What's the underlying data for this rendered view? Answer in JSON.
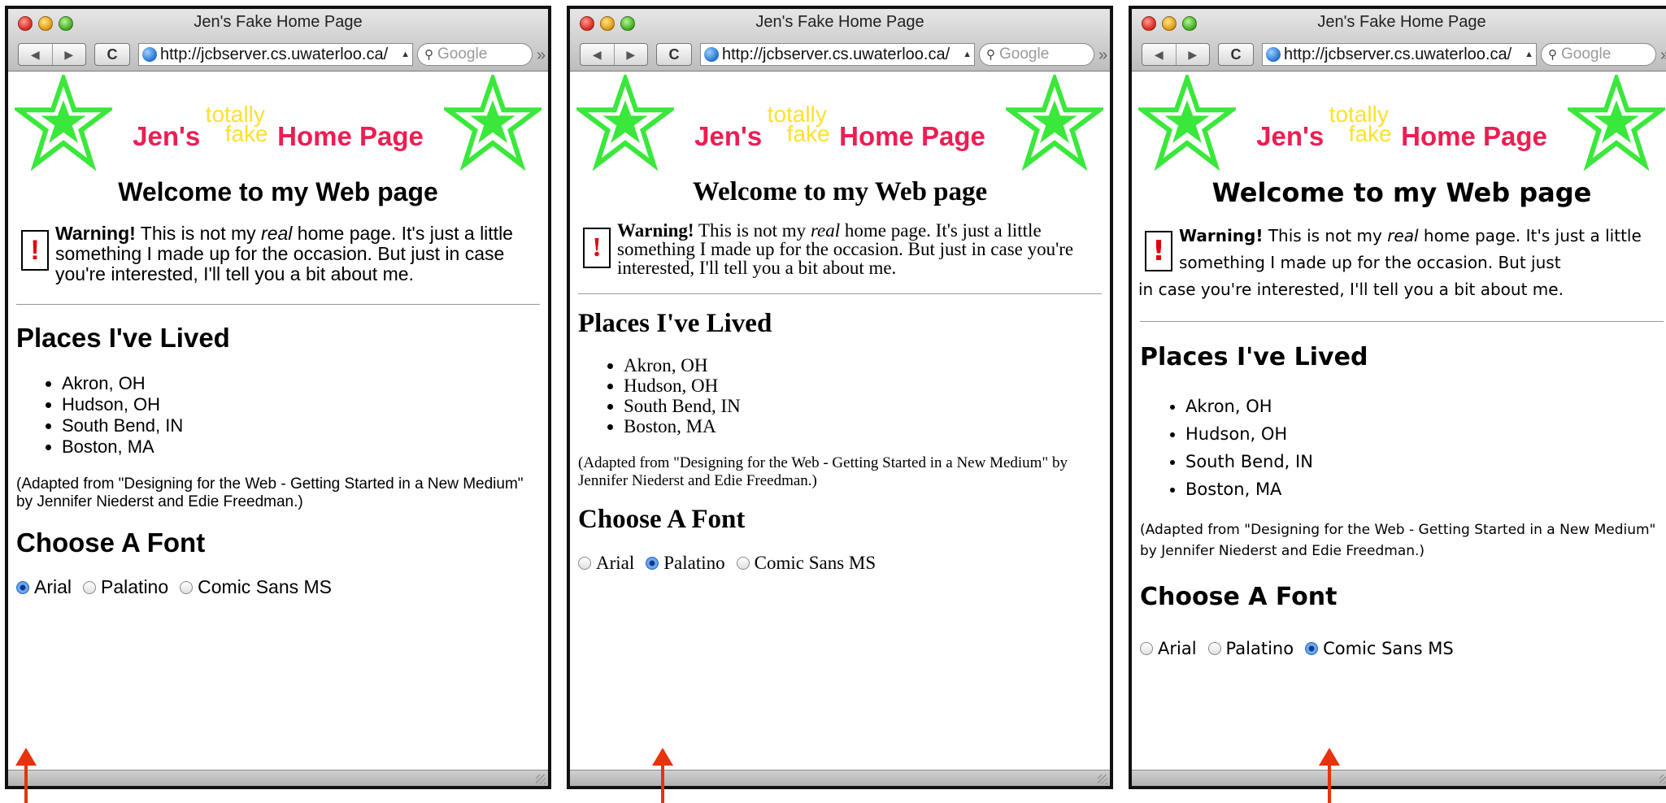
{
  "browser": {
    "window_title": "Jen's Fake Home Page",
    "url": "http://jcbserver.cs.uwaterloo.ca/",
    "search_placeholder": "Google",
    "back_glyph": "◀",
    "forward_glyph": "▶",
    "reload_glyph": "C",
    "overflow_glyph": "»",
    "url_dropdown_glyph": "▲"
  },
  "page": {
    "banner": {
      "jens": "Jen's",
      "totally": "totally",
      "fake": "fake",
      "home_page": "Home Page",
      "colors": {
        "star": "#39e83a",
        "title": "#ee1d52",
        "accent": "#ffe02e"
      }
    },
    "welcome": "Welcome to my Web page",
    "warning": {
      "icon_glyph": "!",
      "bold": "Warning!",
      "before_italic": " This is not my ",
      "italic": "real",
      "after_italic": " home page. It's just a little something I made up for the occasion. But just in case you're interested, I'll tell you a bit about me.",
      "v3_line1": " home page. It's just a little something I made up for the occasion. But just ",
      "v3_line2": "in case you're interested, I'll tell you a bit about me."
    },
    "places_heading": "Places I've Lived",
    "places": [
      "Akron, OH",
      "Hudson, OH",
      "South Bend, IN",
      "Boston, MA"
    ],
    "credit": "(Adapted from \"Designing for the Web - Getting Started in a New Medium\" by Jennifer Niederst and Edie Freedman.)",
    "choose_heading": "Choose A Font",
    "font_options": [
      "Arial",
      "Palatino",
      "Comic Sans MS"
    ]
  },
  "variants": [
    {
      "selected_font": "Arial"
    },
    {
      "selected_font": "Palatino"
    },
    {
      "selected_font": "Comic Sans MS"
    }
  ],
  "annotation_arrow_color": "#e8320e"
}
